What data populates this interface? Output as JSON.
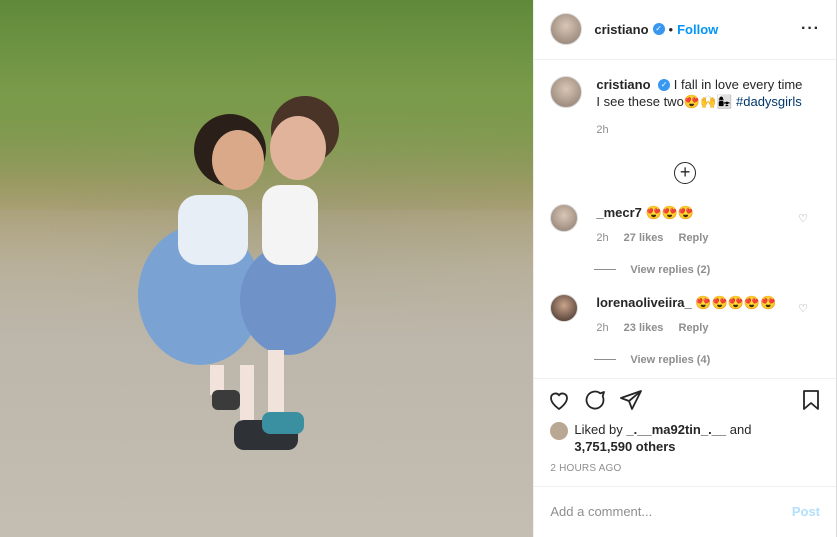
{
  "header": {
    "username": "cristiano",
    "separator": "•",
    "follow_label": "Follow",
    "more_icon": "more-horizontal-icon"
  },
  "caption": {
    "username": "cristiano",
    "text": "I fall in love every time I see these two",
    "emojis": "😍🙌👩‍👧",
    "hashtag": "#dadysgirls",
    "time": "2h"
  },
  "comments": [
    {
      "username": "_mecr7",
      "text": "😍😍😍",
      "time": "2h",
      "likes": "27 likes",
      "reply_label": "Reply",
      "view_replies": "View replies (2)"
    },
    {
      "username": "lorenaoliveiira_",
      "text": "😍😍😍😍😍",
      "time": "2h",
      "likes": "23 likes",
      "reply_label": "Reply",
      "view_replies": "View replies (4)"
    }
  ],
  "likes": {
    "prefix": "Liked by ",
    "user": "_.__ma92tin_.__",
    "middle": " and",
    "count": "3,751,590 others"
  },
  "posted": "2 HOURS AGO",
  "add_comment": {
    "placeholder": "Add a comment...",
    "post_label": "Post"
  },
  "colors": {
    "accent": "#0095f6",
    "post_disabled": "#b2dffc",
    "secondary_text": "#8e8e8e"
  }
}
